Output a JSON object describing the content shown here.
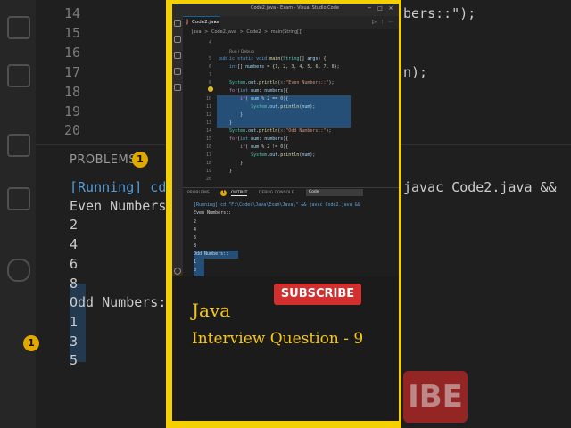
{
  "background": {
    "line_numbers": [
      "14",
      "15",
      "16",
      "17",
      "18",
      "19",
      "20"
    ],
    "problems_label": "PROBLEMS",
    "problems_count": "1",
    "activity_badge": "1",
    "right_text": [
      "bers::\");",
      "n);",
      "javac Code2.java &&"
    ],
    "output_lines": [
      "[Running] cd",
      "Even Numbers:",
      "2",
      "4",
      "6",
      "8",
      "Odd Numbers::",
      "1",
      "3",
      "5"
    ],
    "subscribe_fragment": "IBE"
  },
  "window": {
    "title": "Code2.java - Exam - Visual Studio Code",
    "controls": [
      "─",
      "□",
      "✕"
    ]
  },
  "editor": {
    "tab_label": "Code2.java",
    "tab_icon": "J",
    "breadcrumb": [
      "Java",
      ">",
      "Code2.java",
      ">",
      "Code2",
      ">",
      "main(String[])"
    ],
    "codelens": "Run | Debug",
    "lines": [
      {
        "n": "4",
        "html": ""
      },
      {
        "n": "5",
        "html": "<span class=\"kw\">public</span> <span class=\"kw\">static</span> <span class=\"kw\">void</span> <span class=\"fn\">main</span>(<span class=\"ty\">String</span>[] <span class=\"var\">args</span>) {"
      },
      {
        "n": "6",
        "html": "    <span class=\"kw\">int</span>[] <span class=\"var\">numbers</span> = {<span class=\"num\">1</span>, <span class=\"num\">2</span>, <span class=\"num\">3</span>, <span class=\"num\">4</span>, <span class=\"num\">5</span>, <span class=\"num\">6</span>, <span class=\"num\">7</span>, <span class=\"num\">8</span>};"
      },
      {
        "n": "7",
        "html": ""
      },
      {
        "n": "8",
        "html": "    <span class=\"ty\">System</span>.<span class=\"var\">out</span>.<span class=\"fn\">println</span>(<span class=\"prm\">x:</span><span class=\"str\">\"Even Numbers::\"</span>);"
      },
      {
        "n": "9",
        "html": "    <span class=\"ctl\">for</span>(<span class=\"kw\">int</span> <span class=\"var\">num</span>: <span class=\"var\">numbers</span>){"
      },
      {
        "n": "10",
        "html": "        <span class=\"ctl\">if</span>( <span class=\"var\">num</span> % <span class=\"num\">2</span> == <span class=\"num\">0</span>){"
      },
      {
        "n": "11",
        "html": "            <span class=\"ty\">System</span>.<span class=\"var\">out</span>.<span class=\"fn\">println</span>(<span class=\"var\">num</span>);"
      },
      {
        "n": "12",
        "html": "        }"
      },
      {
        "n": "13",
        "html": "    }"
      },
      {
        "n": "14",
        "html": "    <span class=\"ty\">System</span>.<span class=\"var\">out</span>.<span class=\"fn\">println</span>(<span class=\"prm\">x:</span><span class=\"str\">\"Odd Numbers::\"</span>);"
      },
      {
        "n": "15",
        "html": "    <span class=\"ctl\">for</span>(<span class=\"kw\">int</span> <span class=\"var\">num</span>: <span class=\"var\">numbers</span>){"
      },
      {
        "n": "16",
        "html": "        <span class=\"ctl\">if</span>( <span class=\"var\">num</span> % <span class=\"num\">2</span> != <span class=\"num\">0</span>){"
      },
      {
        "n": "17",
        "html": "            <span class=\"ty\">System</span>.<span class=\"var\">out</span>.<span class=\"fn\">println</span>(<span class=\"var\">num</span>);"
      },
      {
        "n": "18",
        "html": "        }"
      },
      {
        "n": "19",
        "html": "    }"
      },
      {
        "n": "20",
        "html": ""
      }
    ]
  },
  "panel": {
    "tabs": [
      "PROBLEMS",
      "OUTPUT",
      "DEBUG CONSOLE"
    ],
    "problems_count": "1",
    "selected_channel": "Code",
    "output": [
      "[Running] cd \"F:\\Codes\\Java\\Exam\\Java\\\" && javac Code2.java &&",
      "Even Numbers::",
      "2",
      "4",
      "6",
      "8",
      "Odd Numbers::",
      "1",
      "3",
      "5"
    ]
  },
  "overlay": {
    "subscribe_label": "SUBSCRIBE",
    "title": "Java",
    "subtitle": "Interview Question - 9"
  },
  "colors": {
    "frame": "#f5d000",
    "accent_text": "#f5c518",
    "subscribe": "#d32f2f",
    "selection": "#264f78"
  }
}
